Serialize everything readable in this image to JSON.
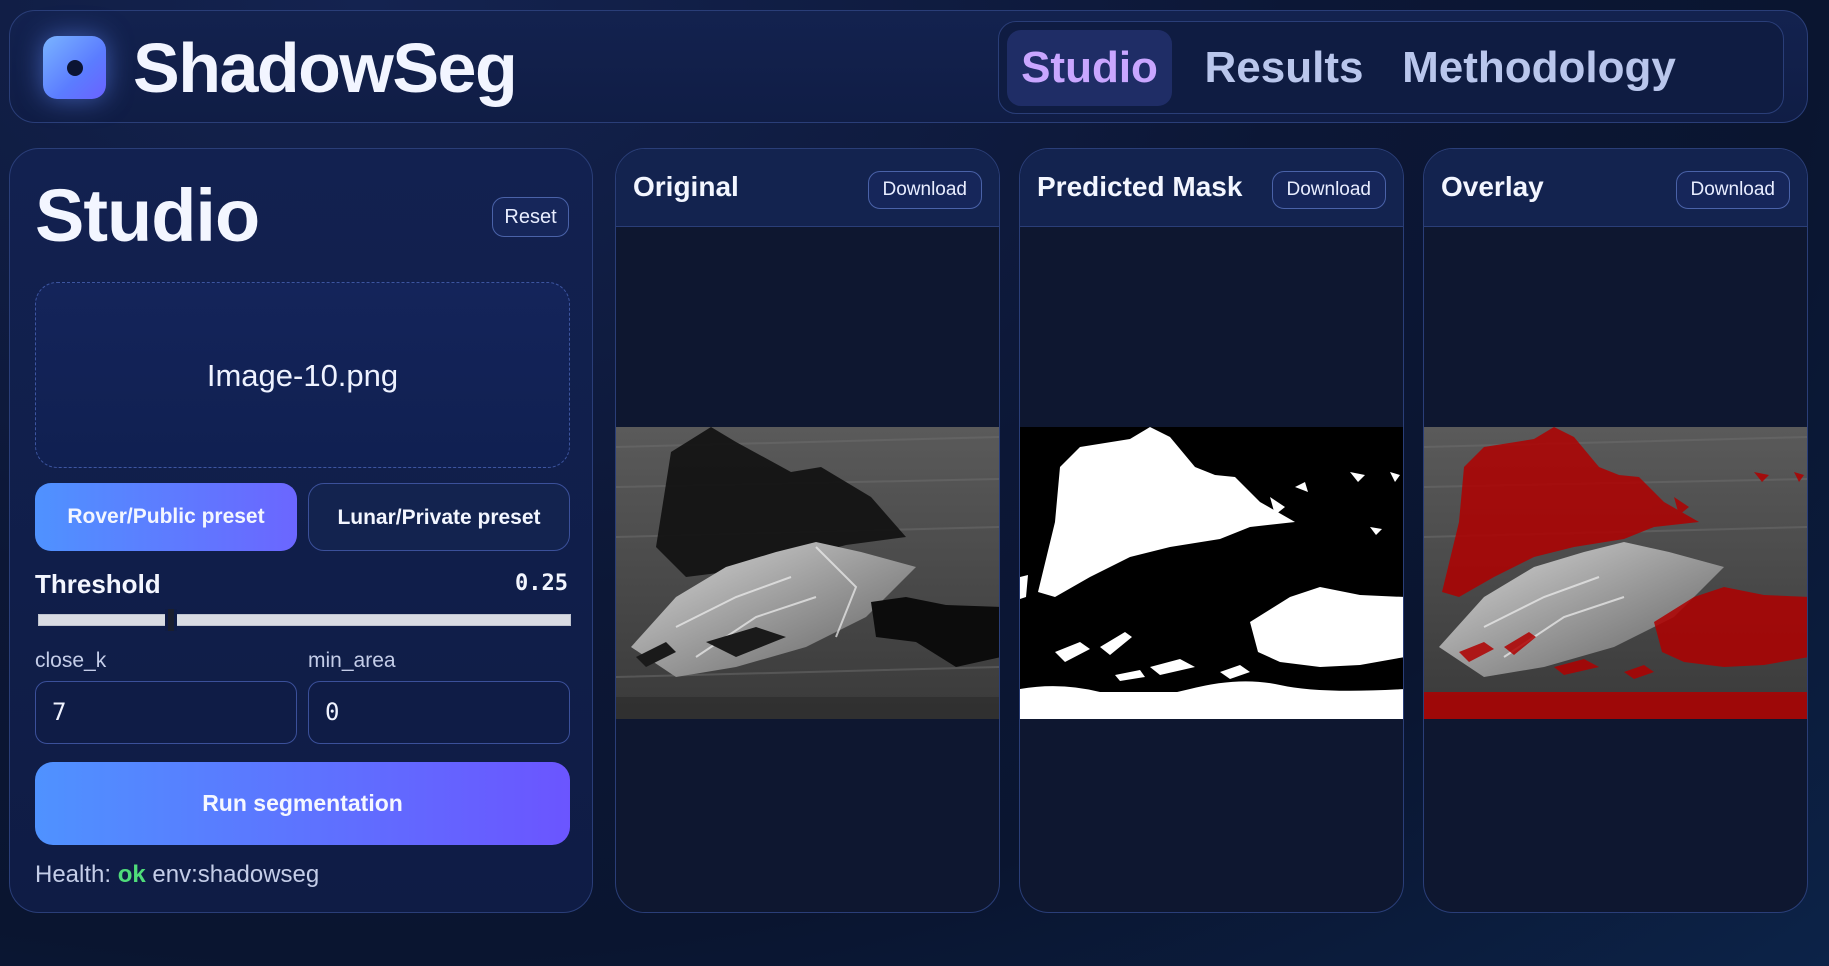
{
  "app": {
    "name": "ShadowSeg"
  },
  "nav": {
    "tabs": [
      {
        "label": "Studio",
        "active": true
      },
      {
        "label": "Results",
        "active": false
      },
      {
        "label": "Methodology",
        "active": false
      }
    ]
  },
  "panel": {
    "title": "Studio",
    "reset_label": "Reset",
    "file_name": "Image-10.png",
    "preset_primary": "Rover/Public preset",
    "preset_secondary": "Lunar/Private preset",
    "threshold_label": "Threshold",
    "threshold_value": "0.25",
    "threshold_fraction": 0.25,
    "close_k_label": "close_k",
    "close_k_value": "7",
    "min_area_label": "min_area",
    "min_area_value": "0",
    "run_label": "Run segmentation",
    "health_prefix": "Health:",
    "health_status": "ok",
    "health_env": "env:shadowseg"
  },
  "cards": [
    {
      "title": "Original",
      "download_label": "Download"
    },
    {
      "title": "Predicted Mask",
      "download_label": "Download"
    },
    {
      "title": "Overlay",
      "download_label": "Download"
    }
  ],
  "colors": {
    "accent_start": "#4f92ff",
    "accent_end": "#6b55ff",
    "active_tab_text": "#c9a6ff",
    "health_ok": "#4fdc7a",
    "overlay_red": "#b00000"
  }
}
